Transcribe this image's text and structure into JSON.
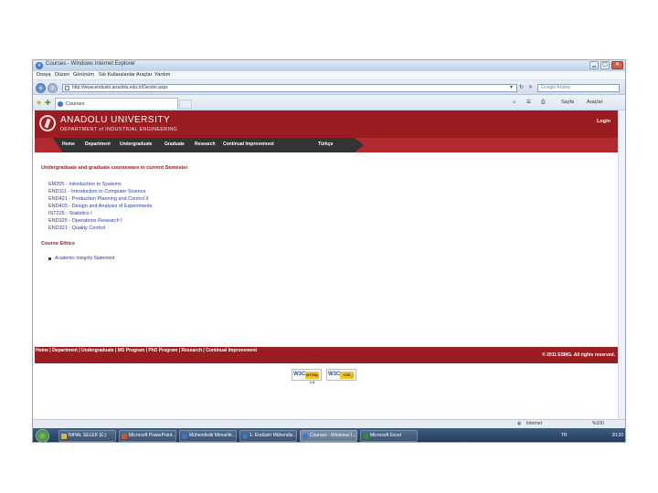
{
  "window": {
    "title": "Courses - Windows Internet Explorer",
    "buttons": [
      "▁",
      "▢",
      "✕"
    ]
  },
  "menu": [
    "Dosya",
    "Düzen",
    "Görünüm",
    "Sık Kullanılanlar",
    "Araçlar",
    "Yardım"
  ],
  "address": {
    "url": "http://www.endustri.anadolu.edu.tr/Dersler.aspx",
    "search_placeholder": "Google Arama"
  },
  "tab": {
    "label": "Courses",
    "commands": [
      "Sayfa",
      "Araçlar"
    ]
  },
  "site": {
    "title": "ANADOLU UNIVERSITY",
    "subtitle": "DEPARTMENT of INDUSTRIAL ENGINEERING",
    "login": "Login",
    "nav": [
      "Home",
      "Department",
      "Undergraduate",
      "Graduate",
      "Research",
      "Continual Improvement",
      "Türkçe"
    ]
  },
  "content": {
    "courseware_heading": "Undergraduate and graduate courseware in current Semester",
    "courses": [
      "EM205 - Introduction to Systems",
      "END111 - Introduction to Computer Science",
      "END421 - Production Planning and Control II",
      "END403 - Design and Analysis of Experiments",
      "IST225 - Statistics I",
      "END325 - Operations Research I",
      "END321 - Quality Control"
    ],
    "ethics_heading": "Course Ethics",
    "ethics_link": "Academic Integrity Statement"
  },
  "footer": {
    "links": "Home | Department | Undergraduate | MS Program | PhD Program | Research | Continual Improvement",
    "copyright": "© 2011 ESMG. All rights reserved."
  },
  "badges": [
    {
      "w3c": "W3C",
      "label": "XHTML 1.0"
    },
    {
      "w3c": "W3C",
      "label": "CSS"
    }
  ],
  "status": {
    "zone": "Internet",
    "zoom": "%100"
  },
  "taskbar": {
    "tasks": [
      "NIHAL SELEK (E:)",
      "Microsoft PowerPoint...",
      "Mühendislik Mimarlık...",
      "1- Endüstri Mühendis...",
      "Courses - Windows I...",
      "Microsoft Excel"
    ],
    "tray_lang": "TR",
    "clock": "20:20"
  },
  "colors": {
    "brand_red": "#9a1d22",
    "nav_dark": "#333333",
    "link_blue": "#2a3d9e"
  }
}
